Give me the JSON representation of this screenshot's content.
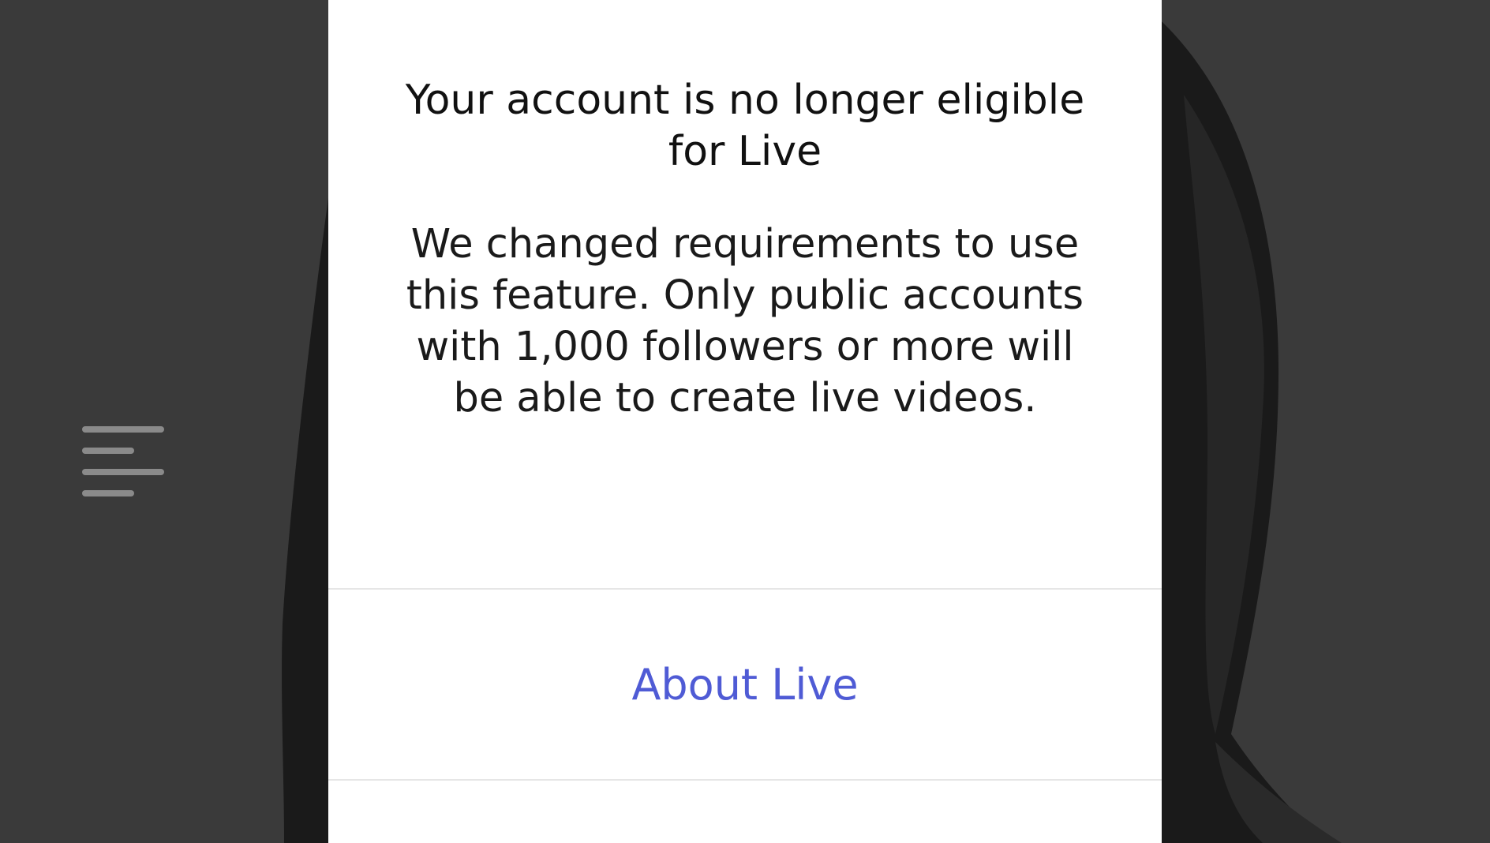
{
  "dialog": {
    "title": "Your account is no longer eligible for Live",
    "body": "We changed requirements to use this feature. Only public accounts with 1,000 followers or more will be able to create live videos.",
    "primary_action": "About Live"
  },
  "icons": {
    "menu": "menu-lines-icon"
  },
  "colors": {
    "background": "#393939",
    "dialog": "#ffffff",
    "title_text": "#111111",
    "body_text": "#1a1a1a",
    "link": "#4f5bd5",
    "divider": "#e6e6e6"
  }
}
